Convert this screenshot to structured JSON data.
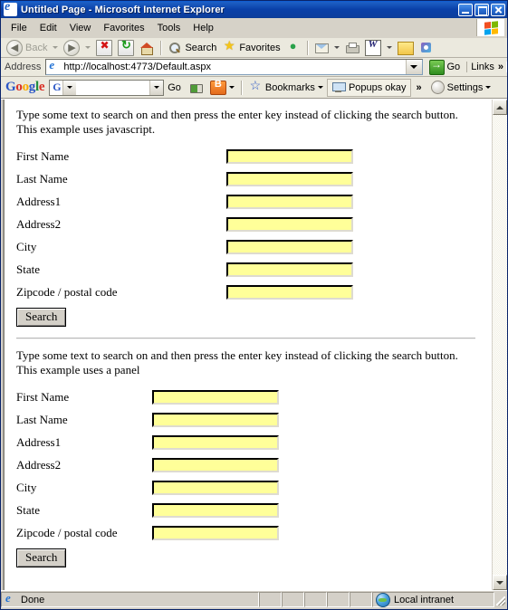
{
  "window": {
    "title": "Untitled Page - Microsoft Internet Explorer",
    "ie_icon": "ie-e-icon",
    "controls": {
      "minimize": "minimize-icon",
      "maximize": "maximize-icon",
      "close": "close-icon"
    }
  },
  "menubar": {
    "items": [
      {
        "label": "File"
      },
      {
        "label": "Edit"
      },
      {
        "label": "View"
      },
      {
        "label": "Favorites"
      },
      {
        "label": "Tools"
      },
      {
        "label": "Help"
      }
    ],
    "logo": "windows-flag-icon"
  },
  "toolbar": {
    "back_label": "Back",
    "forward_label": "",
    "stop_label": "",
    "refresh_label": "",
    "home_label": "",
    "search_label": "Search",
    "favorites_label": "Favorites",
    "media_label": "",
    "mail_label": "",
    "print_label": "",
    "word_label": "",
    "notes_label": "",
    "messenger_label": ""
  },
  "address": {
    "label": "Address",
    "url": "http://localhost:4773/Default.aspx",
    "go_label": "Go",
    "links_label": "Links",
    "chevron": "»"
  },
  "google_toolbar": {
    "logo": {
      "g1": "G",
      "o1": "o",
      "o2": "o",
      "g2": "g",
      "l": "l",
      "e": "e"
    },
    "search_value": "",
    "search_placeholder": "",
    "mini_g": "G",
    "go_label": "Go",
    "bookmarks_label": "Bookmarks",
    "popups_label": "Popups okay",
    "chevron": "»",
    "settings_label": "Settings"
  },
  "page": {
    "sections": [
      {
        "intro": "Type some text to search on and then press the enter key instead of clicking the search button. This example uses javascript.",
        "fields": [
          {
            "label": "First Name",
            "value": ""
          },
          {
            "label": "Last Name",
            "value": ""
          },
          {
            "label": "Address1",
            "value": ""
          },
          {
            "label": "Address2",
            "value": ""
          },
          {
            "label": "City",
            "value": ""
          },
          {
            "label": "State",
            "value": ""
          },
          {
            "label": "Zipcode / postal code",
            "value": ""
          }
        ],
        "button_label": "Search"
      },
      {
        "intro": "Type some text to search on and then press the enter key instead of clicking the search button. This example uses a panel",
        "fields": [
          {
            "label": "First Name",
            "value": ""
          },
          {
            "label": "Last Name",
            "value": ""
          },
          {
            "label": "Address1",
            "value": ""
          },
          {
            "label": "Address2",
            "value": ""
          },
          {
            "label": "City",
            "value": ""
          },
          {
            "label": "State",
            "value": ""
          },
          {
            "label": "Zipcode / postal code",
            "value": ""
          }
        ],
        "button_label": "Search"
      }
    ],
    "field_bg_color": "#ffff99"
  },
  "statusbar": {
    "status_text": "Done",
    "zone_text": "Local intranet",
    "zone_icon": "globe-icon"
  }
}
